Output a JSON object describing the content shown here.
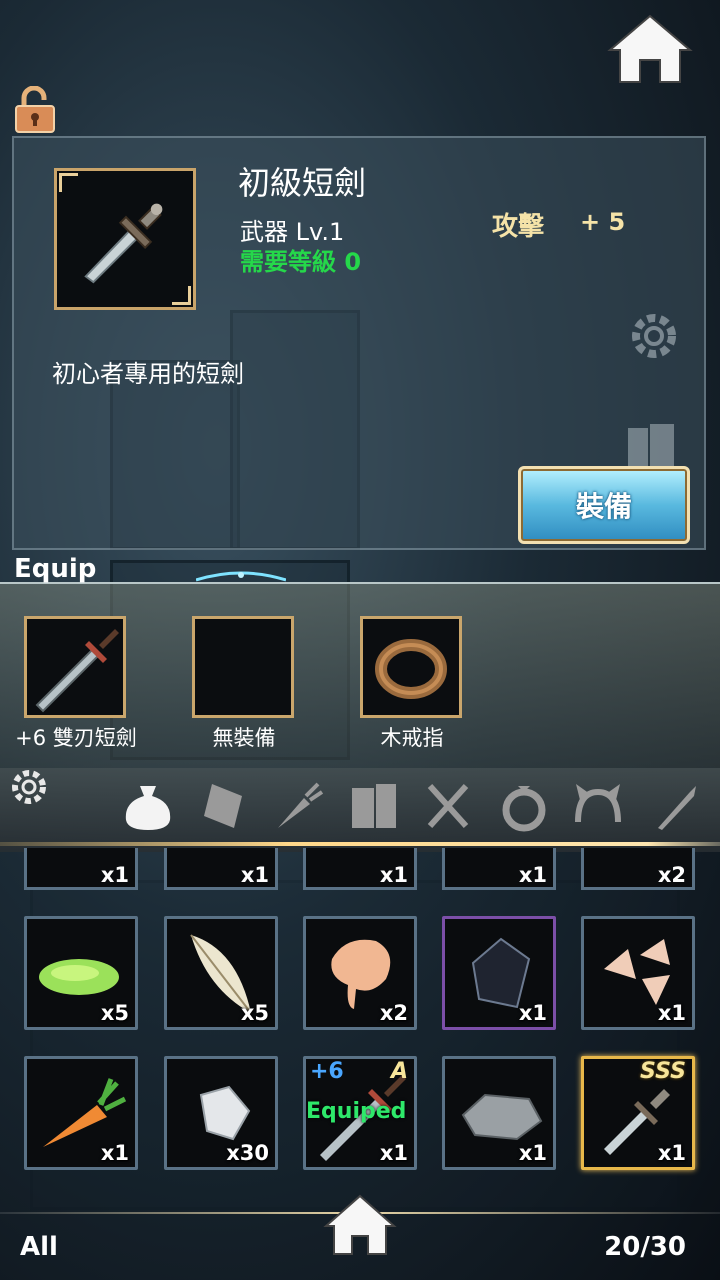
{
  "detail": {
    "name": "初級短劍",
    "type_level": "武器 Lv.1",
    "required_level": "需要等級 0",
    "stat_label": "攻擊",
    "stat_value": "+ 5",
    "description": "初心者專用的短劍",
    "equip_button": "裝備"
  },
  "equip": {
    "title": "Equip",
    "slots": [
      {
        "label": "+6 雙刃短劍",
        "icon": "dagger-icon"
      },
      {
        "label": "無裝備",
        "icon": ""
      },
      {
        "label": "木戒指",
        "icon": "ring-icon"
      }
    ]
  },
  "categories": [
    "bag-icon",
    "card-icon",
    "carrot-icon",
    "books-icon",
    "fork-knife-icon",
    "ring-icon",
    "headband-icon",
    "sword-icon"
  ],
  "inventory": {
    "top_partial_counts": [
      "x1",
      "x1",
      "x1",
      "x1",
      "x2"
    ],
    "row1": [
      {
        "icon": "green-slime-icon",
        "count": "x5"
      },
      {
        "icon": "feather-icon",
        "count": "x5"
      },
      {
        "icon": "meat-icon",
        "count": "x2"
      },
      {
        "icon": "dark-crystal-icon",
        "count": "x1"
      },
      {
        "icon": "shell-fragments-icon",
        "count": "x1"
      }
    ],
    "row2": [
      {
        "icon": "carrot-icon",
        "count": "x1"
      },
      {
        "icon": "crystal-icon",
        "count": "x30"
      },
      {
        "icon": "dagger-icon",
        "count": "x1",
        "plus": "+6",
        "rank": "A",
        "status": "Equiped"
      },
      {
        "icon": "stone-icon",
        "count": "x1"
      },
      {
        "icon": "short-sword-icon",
        "count": "x1",
        "rank": "SSS"
      }
    ]
  },
  "footer": {
    "filter": "All",
    "capacity": "20/30"
  }
}
